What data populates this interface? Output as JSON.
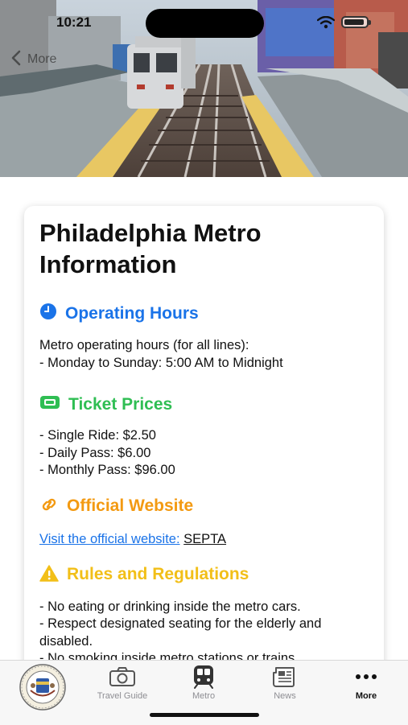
{
  "status_bar": {
    "time": "10:21"
  },
  "nav": {
    "back_label": "More"
  },
  "card": {
    "title": "Philadelphia Metro Information",
    "sections": [
      {
        "heading": "Operating Hours",
        "icon": "clock-icon",
        "color": "#1a73e8",
        "lines": [
          "Metro operating hours (for all lines):",
          "- Monday to Sunday: 5:00 AM to Midnight"
        ]
      },
      {
        "heading": "Ticket Prices",
        "icon": "ticket-icon",
        "color": "#2fbe53",
        "lines": [
          "- Single Ride: $2.50",
          "- Daily Pass: $6.00",
          "- Monthly Pass: $96.00"
        ]
      },
      {
        "heading": "Official Website",
        "icon": "link-icon",
        "color": "#f39a12",
        "link_text": "Visit the official website:",
        "site_name": "SEPTA"
      },
      {
        "heading": "Rules and Regulations",
        "icon": "warning-icon",
        "color": "#f2bf18",
        "lines": [
          "- No eating or drinking inside the metro cars.",
          "- Respect designated seating for the elderly and disabled.",
          "- No smoking inside metro stations or trains."
        ]
      }
    ]
  },
  "tabbar": {
    "items": [
      {
        "label": "",
        "icon": "city-seal-icon",
        "active": false
      },
      {
        "label": "Travel Guide",
        "icon": "camera-icon",
        "active": false
      },
      {
        "label": "Metro",
        "icon": "train-icon",
        "active": false
      },
      {
        "label": "News",
        "icon": "newspaper-icon",
        "active": false
      },
      {
        "label": "More",
        "icon": "more-icon",
        "active": true
      }
    ]
  }
}
